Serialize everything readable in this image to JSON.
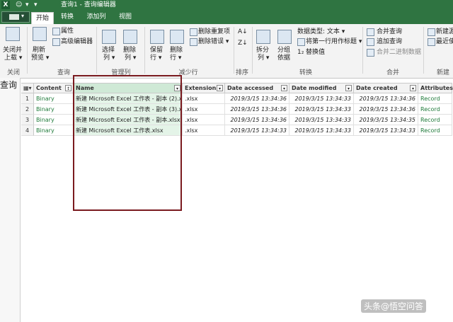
{
  "titlebar": {
    "app_icon": "X",
    "title": "查询1 - 查询编辑器"
  },
  "tabs": [
    "开始",
    "转换",
    "添加列",
    "视图"
  ],
  "ribbon": {
    "close_load": "关闭并\n上载",
    "close_load_1": "关闭并",
    "close_load_2": "上载 ▾",
    "refresh_1": "刷新",
    "refresh_2": "预览 ▾",
    "properties": "属性",
    "advanced_editor": "高级编辑器",
    "choose_1": "选择",
    "choose_2": "列 ▾",
    "remove_1": "删除",
    "remove_2": "列 ▾",
    "keep_1": "保留",
    "keep_2": "行 ▾",
    "delete_1": "删除",
    "delete_2": "行 ▾",
    "remove_dupes": "删除重复项",
    "remove_errors": "删除错误 ▾",
    "split_1": "拆分",
    "split_2": "列 ▾",
    "group_1": "分组",
    "group_2": "依据",
    "data_type": "数据类型: 文本 ▾",
    "first_row_header": "将第一行用作标题 ▾",
    "replace_values": "替换值",
    "merge_queries": "合并查询",
    "append_queries": "追加查询",
    "combine_binaries": "合并二进制数据",
    "new_source": "新建源",
    "recent_sources": "最近使",
    "groups": {
      "close": "关闭",
      "query": "查询",
      "manage_cols": "管理列",
      "reduce_rows": "减少行",
      "sort": "排序",
      "transform": "转换",
      "combine": "合并",
      "new_query": "新建"
    }
  },
  "left_pane_label": "查询",
  "table": {
    "columns": [
      "Content",
      "Name",
      "Extension",
      "Date accessed",
      "Date modified",
      "Date created",
      "Attributes"
    ],
    "rows": [
      [
        "1",
        "Binary",
        "新建 Microsoft Excel 工作表 - 副本 (2).xlsx",
        ".xlsx",
        "2019/3/15 13:34:36",
        "2019/3/15 13:34:33",
        "2019/3/15 13:34:36",
        "Record"
      ],
      [
        "2",
        "Binary",
        "新建 Microsoft Excel 工作表 - 副本 (3).xlsx",
        ".xlsx",
        "2019/3/15 13:34:36",
        "2019/3/15 13:34:33",
        "2019/3/15 13:34:36",
        "Record"
      ],
      [
        "3",
        "Binary",
        "新建 Microsoft Excel 工作表 - 副本.xlsx",
        ".xlsx",
        "2019/3/15 13:34:36",
        "2019/3/15 13:34:33",
        "2019/3/15 13:34:35",
        "Record"
      ],
      [
        "4",
        "Binary",
        "新建 Microsoft Excel 工作表.xlsx",
        ".xlsx",
        "2019/3/15 13:34:33",
        "2019/3/15 13:34:33",
        "2019/3/15 13:34:33",
        "Record"
      ]
    ]
  },
  "watermark": "头条@悟空问答",
  "colors": {
    "title_green": "#2f7441",
    "accent_green": "#1f7a3a",
    "highlight_box": "#7a1a1f"
  }
}
